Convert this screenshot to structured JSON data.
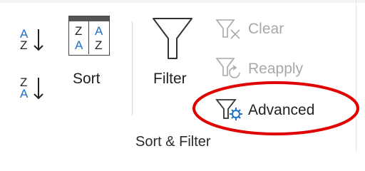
{
  "ribbon": {
    "group_label": "Sort & Filter",
    "sort_az": {
      "top": "A",
      "bottom": "Z"
    },
    "sort_za": {
      "top": "Z",
      "bottom": "A"
    },
    "sort_dialog_grid": [
      "Z",
      "A",
      "A",
      "Z"
    ],
    "sort_label": "Sort",
    "filter_label": "Filter",
    "clear_label": "Clear",
    "reapply_label": "Reapply",
    "advanced_label": "Advanced"
  },
  "colors": {
    "accent_blue": "#1f6fc5",
    "highlight_ellipse": "#e00000",
    "disabled_text": "#a8a8a8"
  }
}
